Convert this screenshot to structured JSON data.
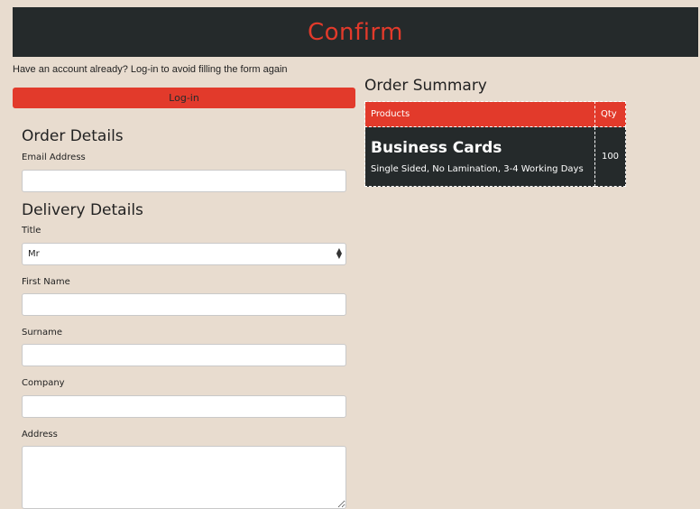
{
  "header": {
    "title": "Confirm"
  },
  "login": {
    "hint": "Have an account already? Log-in to avoid filling the form again",
    "button_label": "Log-in"
  },
  "form": {
    "order_details_heading": "Order Details",
    "email_label": "Email Address",
    "email_value": "",
    "delivery_heading": "Delivery Details",
    "title_label": "Title",
    "title_selected": "Mr",
    "first_name_label": "First Name",
    "first_name_value": "",
    "surname_label": "Surname",
    "surname_value": "",
    "company_label": "Company",
    "company_value": "",
    "address_label": "Address",
    "address_value": ""
  },
  "summary": {
    "heading": "Order Summary",
    "columns": [
      "Products",
      "Qty"
    ],
    "rows": [
      {
        "product": "Business Cards",
        "details": "Single Sided, No Lamination, 3-4 Working Days",
        "qty": "100"
      }
    ]
  },
  "colors": {
    "accent": "#e23a2b",
    "dark": "#252a2b",
    "background": "#e8dccf"
  }
}
